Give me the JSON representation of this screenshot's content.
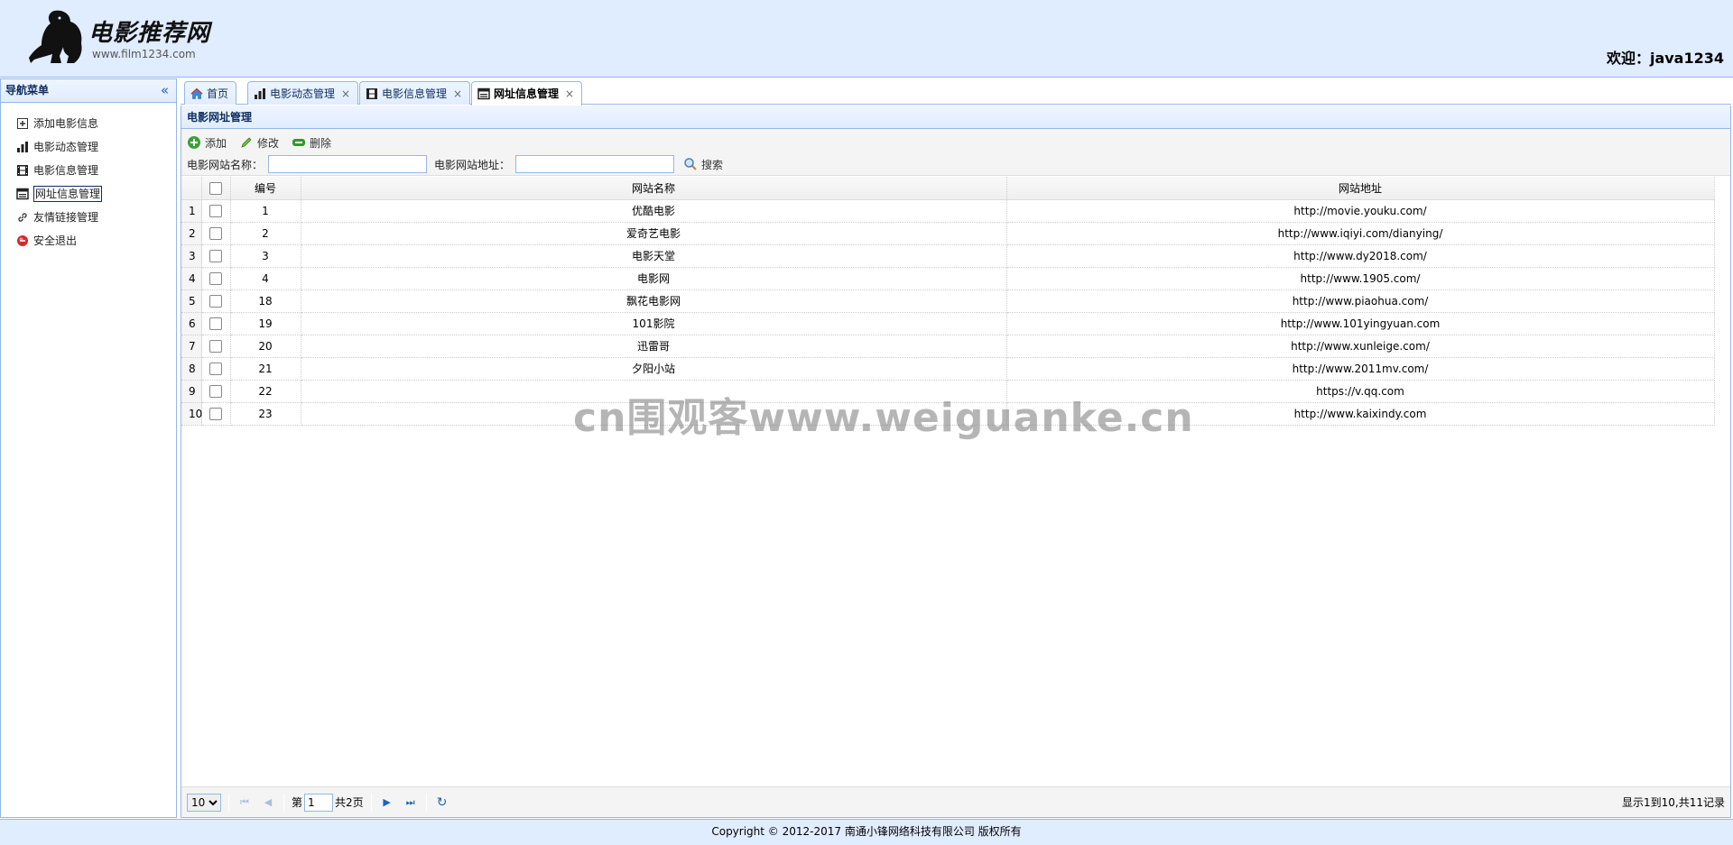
{
  "header": {
    "logo_title": "电影推荐网",
    "logo_url": "www.film1234.com",
    "welcome": "欢迎：java1234"
  },
  "sidebar": {
    "title": "导航菜单",
    "items": [
      {
        "label": "添加电影信息",
        "icon": "add-doc-icon"
      },
      {
        "label": "电影动态管理",
        "icon": "bar-chart-icon"
      },
      {
        "label": "电影信息管理",
        "icon": "film-icon"
      },
      {
        "label": "网址信息管理",
        "icon": "web-icon"
      },
      {
        "label": "友情链接管理",
        "icon": "link-icon"
      },
      {
        "label": "安全退出",
        "icon": "exit-icon"
      }
    ]
  },
  "tabs": [
    {
      "label": "首页",
      "icon": "home-icon",
      "closable": false
    },
    {
      "label": "电影动态管理",
      "icon": "bar-chart-icon",
      "closable": true
    },
    {
      "label": "电影信息管理",
      "icon": "film-icon",
      "closable": true
    },
    {
      "label": "网址信息管理",
      "icon": "web-icon",
      "closable": true,
      "selected": true
    }
  ],
  "panel": {
    "title": "电影网址管理",
    "toolbar": {
      "add_label": "添加",
      "edit_label": "修改",
      "delete_label": "删除",
      "name_label": "电影网站名称：",
      "url_label": "电影网站地址：",
      "search_label": "搜索"
    }
  },
  "grid": {
    "columns": [
      "编号",
      "网站名称",
      "网站地址"
    ],
    "rows": [
      {
        "n": "1",
        "id": "1",
        "name": "优酷电影",
        "url": "http://movie.youku.com/"
      },
      {
        "n": "2",
        "id": "2",
        "name": "爱奇艺电影",
        "url": "http://www.iqiyi.com/dianying/"
      },
      {
        "n": "3",
        "id": "3",
        "name": "电影天堂",
        "url": "http://www.dy2018.com/"
      },
      {
        "n": "4",
        "id": "4",
        "name": "电影网",
        "url": "http://www.1905.com/"
      },
      {
        "n": "5",
        "id": "18",
        "name": "飘花电影网",
        "url": "http://www.piaohua.com/"
      },
      {
        "n": "6",
        "id": "19",
        "name": "101影院",
        "url": "http://www.101yingyuan.com"
      },
      {
        "n": "7",
        "id": "20",
        "name": "迅雷哥",
        "url": "http://www.xunleige.com/"
      },
      {
        "n": "8",
        "id": "21",
        "name": "夕阳小站",
        "url": "http://www.2011mv.com/"
      },
      {
        "n": "9",
        "id": "22",
        "name": "",
        "url": "https://v.qq.com"
      },
      {
        "n": "10",
        "id": "23",
        "name": "",
        "url": "http://www.kaixindy.com"
      }
    ]
  },
  "pager": {
    "page_size": "10",
    "page_prefix": "第",
    "page_value": "1",
    "page_total": "共2页",
    "info": "显示1到10,共11记录"
  },
  "footer": {
    "text": "Copyright © 2012-2017 南通小锋网络科技有限公司 版权所有"
  },
  "watermark": "cn围观客www.weiguanke.cn",
  "colors": {
    "header_bg": "#e0ecff",
    "border": "#95b8e7",
    "title_text": "#0e2d5f",
    "icon_blue": "#1d63b5"
  }
}
